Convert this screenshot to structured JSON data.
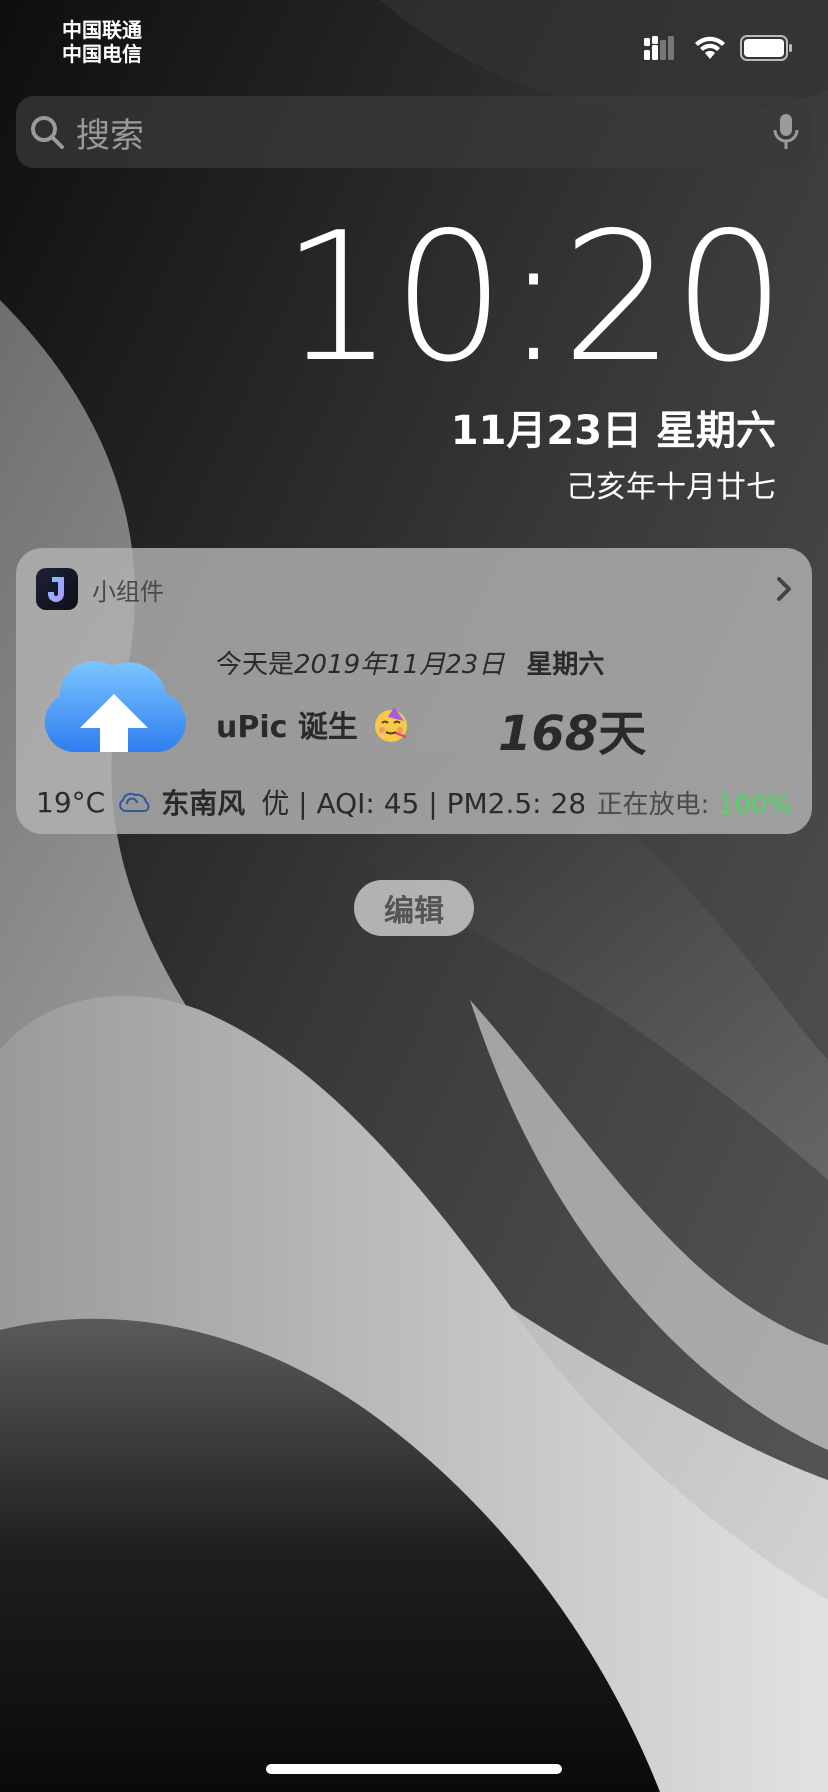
{
  "status_bar": {
    "carrier_1": "中国联通",
    "carrier_2": "中国电信"
  },
  "search": {
    "placeholder": "搜索"
  },
  "lock": {
    "time": "10:20",
    "date": "11月23日 星期六",
    "lunar_date": "己亥年十月廿七"
  },
  "widget": {
    "app_name": "小组件",
    "today_prefix": "今天是",
    "today_date": "2019年11月23日",
    "today_weekday": "星期六",
    "event_name": "uPic 诞生",
    "days_number": "168",
    "days_unit": "天",
    "temperature": "19°C",
    "wind": "东南风",
    "air_quality": "优 | AQI: 45 | PM2.5: 28",
    "battery_label": "正在放电: ",
    "battery_percent": "100%"
  },
  "edit_button": {
    "label": "编辑"
  },
  "colors": {
    "battery_green": "#4cd964",
    "widget_bg": "#b2b2b2",
    "search_bg": "#3a3a3a",
    "cloud_blue": "#4a9bf5"
  },
  "icons": [
    "signal-icon",
    "wifi-icon",
    "battery-icon",
    "search-icon",
    "microphone-icon",
    "app-logo-icon",
    "chevron-right-icon",
    "upload-cloud-icon",
    "party-face-emoji-icon",
    "cloudy-weather-icon"
  ]
}
